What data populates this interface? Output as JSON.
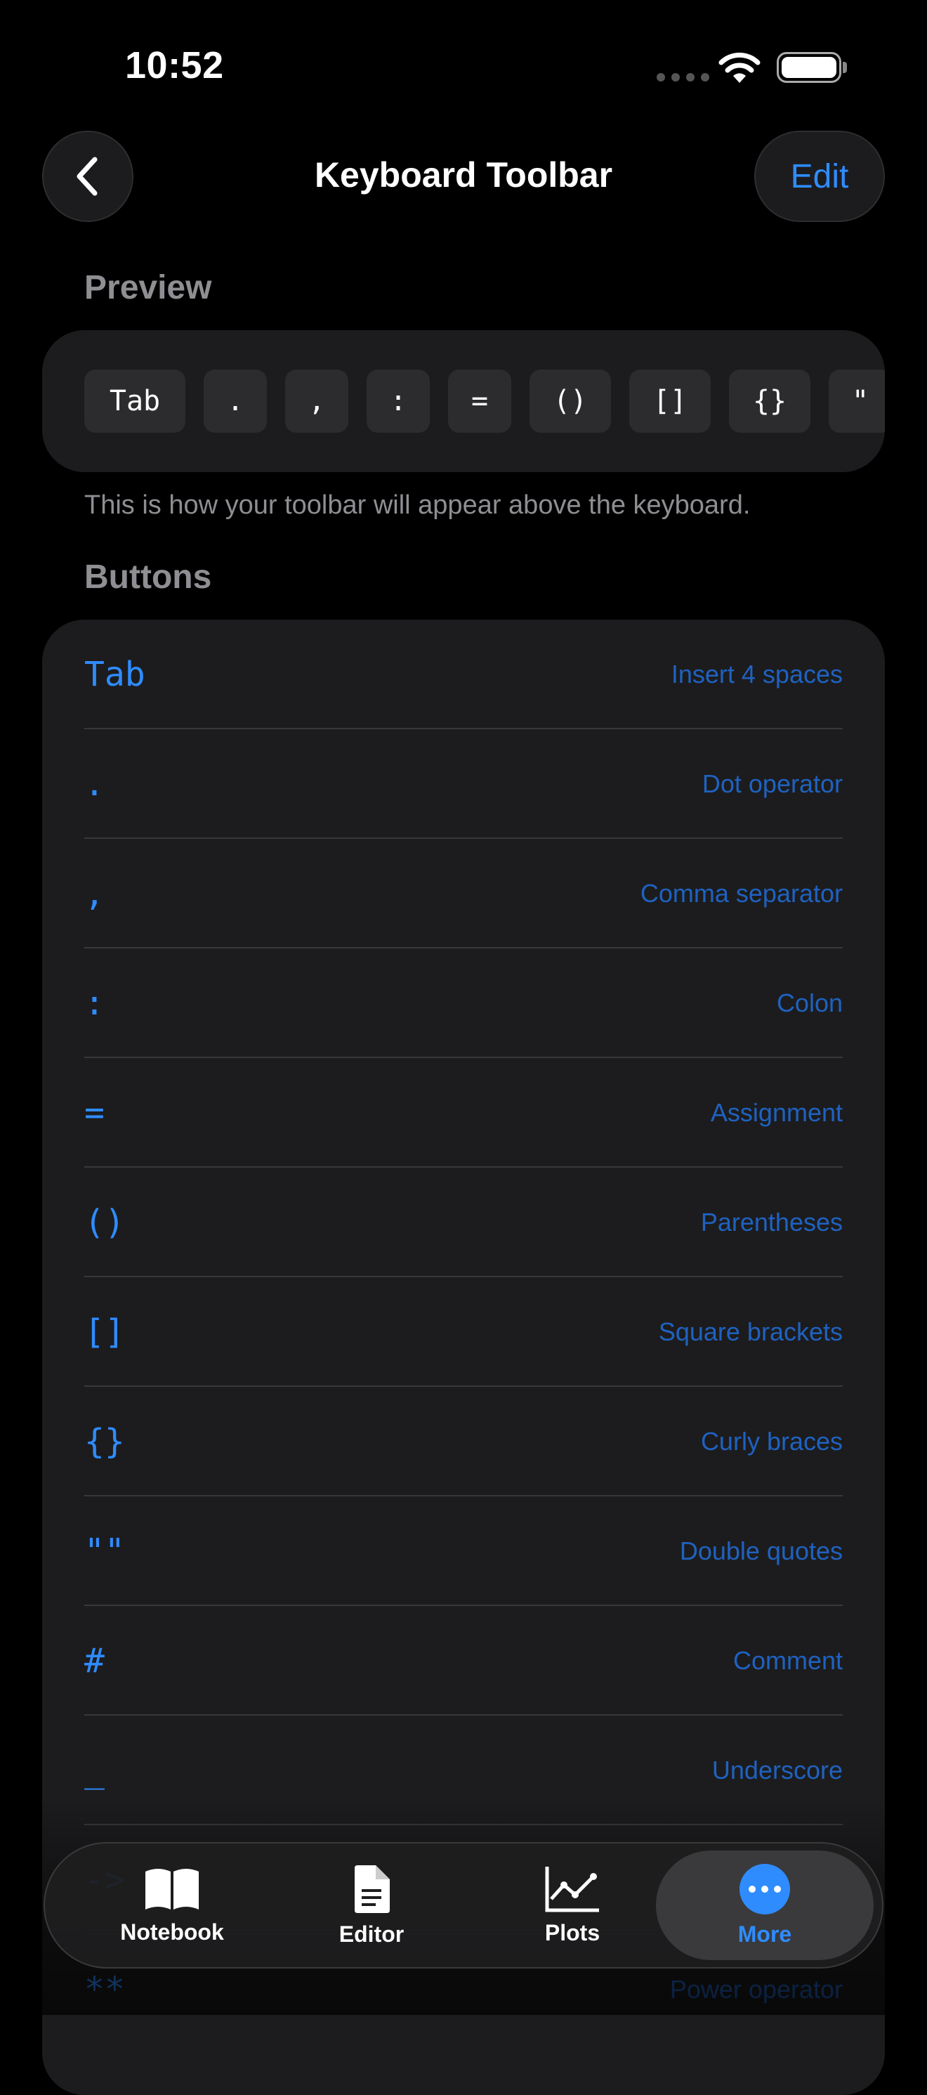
{
  "status": {
    "time": "10:52"
  },
  "nav": {
    "title": "Keyboard Toolbar",
    "edit_label": "Edit"
  },
  "preview": {
    "header": "Preview",
    "keys": [
      "Tab",
      ".",
      ",",
      ":",
      "=",
      "()",
      "[]",
      "{}",
      "\""
    ],
    "description": "This is how your toolbar will appear above the keyboard."
  },
  "buttons": {
    "header": "Buttons",
    "rows": [
      {
        "symbol": "Tab",
        "description": "Insert 4 spaces"
      },
      {
        "symbol": ".",
        "description": "Dot operator"
      },
      {
        "symbol": ",",
        "description": "Comma separator"
      },
      {
        "symbol": ":",
        "description": "Colon"
      },
      {
        "symbol": "=",
        "description": "Assignment"
      },
      {
        "symbol": "()",
        "description": "Parentheses"
      },
      {
        "symbol": "[]",
        "description": "Square brackets"
      },
      {
        "symbol": "{}",
        "description": "Curly braces"
      },
      {
        "symbol": "\"\"",
        "description": "Double quotes"
      },
      {
        "symbol": "#",
        "description": "Comment"
      },
      {
        "symbol": "_",
        "description": "Underscore"
      },
      {
        "symbol": "->",
        "description": ""
      },
      {
        "symbol": "**",
        "description": "Power operator"
      }
    ]
  },
  "tabbar": {
    "tabs": [
      {
        "label": "Notebook",
        "icon": "book-icon"
      },
      {
        "label": "Editor",
        "icon": "document-icon"
      },
      {
        "label": "Plots",
        "icon": "chart-icon"
      },
      {
        "label": "More",
        "icon": "ellipsis-icon",
        "active": true
      }
    ]
  },
  "colors": {
    "accent": "#2f8cff",
    "background": "#000000",
    "card": "#1c1c1e"
  }
}
